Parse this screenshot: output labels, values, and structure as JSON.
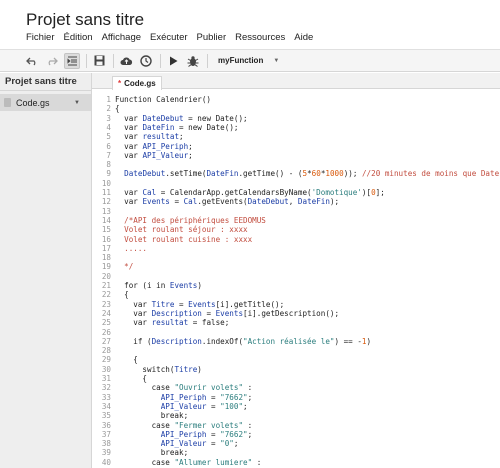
{
  "project_title": "Projet sans titre",
  "menu": [
    "Fichier",
    "Édition",
    "Affichage",
    "Exécuter",
    "Publier",
    "Ressources",
    "Aide"
  ],
  "toolbar": {
    "icons": [
      "undo-icon",
      "redo-icon",
      "indent-icon",
      "save-icon",
      "cloud-publish-icon",
      "triggers-icon",
      "run-icon",
      "debug-icon"
    ],
    "function_select": "myFunction"
  },
  "sidebar": {
    "title": "Projet sans titre",
    "files": [
      {
        "name": "Code.gs"
      }
    ]
  },
  "tab": {
    "modified_marker": "*",
    "label": "Code.gs"
  },
  "colors": {
    "keyword": "#7f0055",
    "variable": "#1b3da6",
    "string": "#2a7d7d",
    "number": "#d8580a",
    "comment": "#c24d3f",
    "plain": "#222222"
  },
  "code_lines": [
    [
      [
        "Function Calendrier()",
        "plain"
      ]
    ],
    [
      [
        "{",
        "plain"
      ]
    ],
    [
      [
        "  var ",
        "plain"
      ],
      [
        "DateDebut",
        "variable"
      ],
      [
        " = new Date();",
        "plain"
      ]
    ],
    [
      [
        "  var ",
        "plain"
      ],
      [
        "DateFin",
        "variable"
      ],
      [
        " = new Date();",
        "plain"
      ]
    ],
    [
      [
        "  var ",
        "plain"
      ],
      [
        "resultat",
        "variable"
      ],
      [
        ";",
        "plain"
      ]
    ],
    [
      [
        "  var ",
        "plain"
      ],
      [
        "API_Periph",
        "variable"
      ],
      [
        ";",
        "plain"
      ]
    ],
    [
      [
        "  var ",
        "plain"
      ],
      [
        "API_Valeur",
        "variable"
      ],
      [
        ";",
        "plain"
      ]
    ],
    [],
    [
      [
        "  ",
        "plain"
      ],
      [
        "DateDebut",
        "variable"
      ],
      [
        ".setTime(",
        "plain"
      ],
      [
        "DateFin",
        "variable"
      ],
      [
        ".getTime() - (",
        "plain"
      ],
      [
        "5",
        "number"
      ],
      [
        "*",
        "plain"
      ],
      [
        "60",
        "number"
      ],
      [
        "*",
        "plain"
      ],
      [
        "1000",
        "number"
      ],
      [
        ")); ",
        "plain"
      ],
      [
        "//20 minutes de moins que DateFin",
        "comment"
      ]
    ],
    [],
    [
      [
        "  var ",
        "plain"
      ],
      [
        "Cal",
        "variable"
      ],
      [
        " = CalendarApp.getCalendarsByName(",
        "plain"
      ],
      [
        "'Domotique'",
        "string"
      ],
      [
        ")[",
        "plain"
      ],
      [
        "0",
        "number"
      ],
      [
        "];",
        "plain"
      ]
    ],
    [
      [
        "  var ",
        "plain"
      ],
      [
        "Events",
        "variable"
      ],
      [
        " = ",
        "plain"
      ],
      [
        "Cal",
        "variable"
      ],
      [
        ".getEvents(",
        "plain"
      ],
      [
        "DateDebut",
        "variable"
      ],
      [
        ", ",
        "plain"
      ],
      [
        "DateFin",
        "variable"
      ],
      [
        ");",
        "plain"
      ]
    ],
    [],
    [
      [
        "  /*API des périphériques EEDOMUS",
        "comment"
      ]
    ],
    [
      [
        "  Volet roulant séjour : xxxx",
        "comment"
      ]
    ],
    [
      [
        "  Volet roulant cuisine : xxxx",
        "comment"
      ]
    ],
    [
      [
        "  .....",
        "comment"
      ]
    ],
    [],
    [
      [
        "  */",
        "comment"
      ]
    ],
    [],
    [
      [
        "  for (i in ",
        "plain"
      ],
      [
        "Events",
        "variable"
      ],
      [
        ")",
        "plain"
      ]
    ],
    [
      [
        "  {",
        "plain"
      ]
    ],
    [
      [
        "    var ",
        "plain"
      ],
      [
        "Titre",
        "variable"
      ],
      [
        " = ",
        "plain"
      ],
      [
        "Events",
        "variable"
      ],
      [
        "[i].getTitle();",
        "plain"
      ]
    ],
    [
      [
        "    var ",
        "plain"
      ],
      [
        "Description",
        "variable"
      ],
      [
        " = ",
        "plain"
      ],
      [
        "Events",
        "variable"
      ],
      [
        "[i].getDescription();",
        "plain"
      ]
    ],
    [
      [
        "    var ",
        "plain"
      ],
      [
        "resultat",
        "variable"
      ],
      [
        " = false;",
        "plain"
      ]
    ],
    [],
    [
      [
        "    if (",
        "plain"
      ],
      [
        "Description",
        "variable"
      ],
      [
        ".indexOf(",
        "plain"
      ],
      [
        "\"Action réalisée le\"",
        "string"
      ],
      [
        ") == -",
        "plain"
      ],
      [
        "1",
        "number"
      ],
      [
        ")",
        "plain"
      ]
    ],
    [],
    [
      [
        "    {",
        "plain"
      ]
    ],
    [
      [
        "      switch(",
        "plain"
      ],
      [
        "Titre",
        "variable"
      ],
      [
        ")",
        "plain"
      ]
    ],
    [
      [
        "      {",
        "plain"
      ]
    ],
    [
      [
        "        case ",
        "plain"
      ],
      [
        "\"Ouvrir volets\"",
        "string"
      ],
      [
        " :",
        "plain"
      ]
    ],
    [
      [
        "          ",
        "plain"
      ],
      [
        "API_Periph",
        "variable"
      ],
      [
        " = ",
        "plain"
      ],
      [
        "\"7662\"",
        "string"
      ],
      [
        ";",
        "plain"
      ]
    ],
    [
      [
        "          ",
        "plain"
      ],
      [
        "API_Valeur",
        "variable"
      ],
      [
        " = ",
        "plain"
      ],
      [
        "\"100\"",
        "string"
      ],
      [
        ";",
        "plain"
      ]
    ],
    [
      [
        "          break;",
        "plain"
      ]
    ],
    [
      [
        "        case ",
        "plain"
      ],
      [
        "\"Fermer volets\"",
        "string"
      ],
      [
        " :",
        "plain"
      ]
    ],
    [
      [
        "          ",
        "plain"
      ],
      [
        "API_Periph",
        "variable"
      ],
      [
        " = ",
        "plain"
      ],
      [
        "\"7662\"",
        "string"
      ],
      [
        ";",
        "plain"
      ]
    ],
    [
      [
        "          ",
        "plain"
      ],
      [
        "API_Valeur",
        "variable"
      ],
      [
        " = ",
        "plain"
      ],
      [
        "\"0\"",
        "string"
      ],
      [
        ";",
        "plain"
      ]
    ],
    [
      [
        "          break;",
        "plain"
      ]
    ],
    [
      [
        "        case ",
        "plain"
      ],
      [
        "\"Allumer lumiere\"",
        "string"
      ],
      [
        " :",
        "plain"
      ]
    ],
    [
      [
        "          ",
        "plain"
      ],
      [
        "API_Periph",
        "variable"
      ],
      [
        " = ",
        "plain"
      ],
      [
        "\"3659\"",
        "string"
      ],
      [
        ";",
        "plain"
      ]
    ]
  ]
}
